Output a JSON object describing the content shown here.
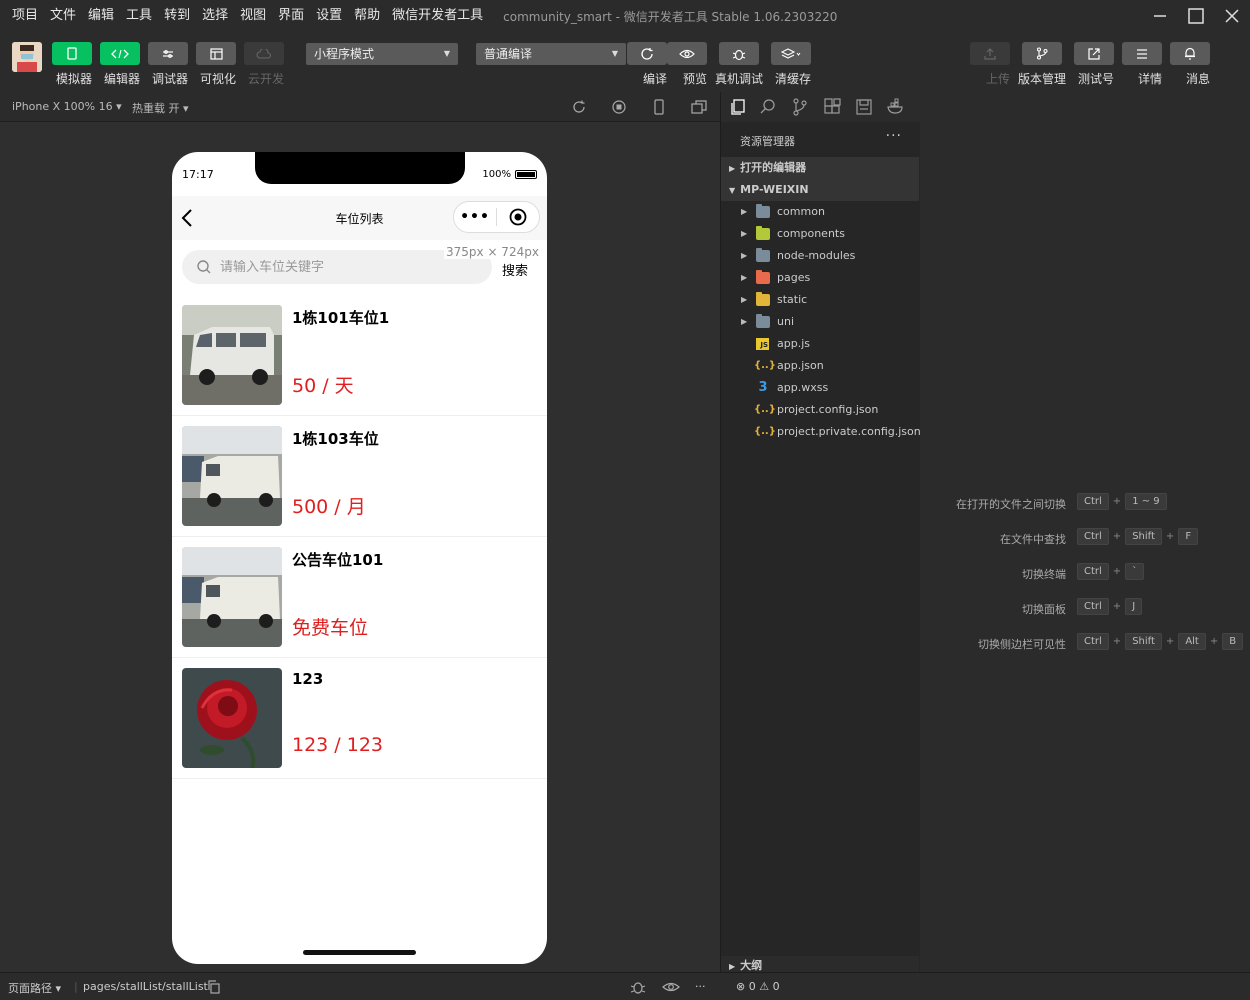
{
  "menu": {
    "items": [
      "项目",
      "文件",
      "编辑",
      "工具",
      "转到",
      "选择",
      "视图",
      "界面",
      "设置",
      "帮助",
      "微信开发者工具"
    ],
    "window_title": "community_smart - 微信开发者工具 Stable 1.06.2303220"
  },
  "toolbar": {
    "simulator": "模拟器",
    "editor": "编辑器",
    "debugger": "调试器",
    "visual": "可视化",
    "cloud": "云开发",
    "mode_select": "小程序模式",
    "compile_select": "普通编译",
    "compile": "编译",
    "preview": "预览",
    "real_debug": "真机调试",
    "clear_cache": "清缓存",
    "upload": "上传",
    "version": "版本管理",
    "test": "测试号",
    "details": "详情",
    "messages": "消息"
  },
  "simbar": {
    "device": "iPhone X 100% 16 ▾",
    "hot_reload": "热重载 开 ▾"
  },
  "phone": {
    "time": "17:17",
    "battery": "100%",
    "nav_title": "车位列表",
    "capsule_dots": "•••",
    "search_placeholder": "请输入车位关键字",
    "search_button": "搜索",
    "size_tip": "375px × 724px",
    "stalls": [
      {
        "name": "1栋101车位1",
        "price": "50 / 天"
      },
      {
        "name": "1栋103车位",
        "price": "500 / 月"
      },
      {
        "name": "公告车位101",
        "price": "免费车位"
      },
      {
        "name": "123",
        "price": "123 / 123"
      }
    ]
  },
  "explorer": {
    "title": "资源管理器",
    "more": "···",
    "open_editors": "打开的编辑器",
    "project": "MP-WEIXIN",
    "folders": [
      "common",
      "components",
      "node-modules",
      "pages",
      "static",
      "uni"
    ],
    "files": [
      "app.js",
      "app.json",
      "app.wxss",
      "project.config.json",
      "project.private.config.json"
    ],
    "file_icons": [
      "JS",
      "{..}",
      "3",
      "{..}",
      "{..}"
    ],
    "outline": "大纲"
  },
  "shortcuts": [
    {
      "desc": "在打开的文件之间切换",
      "keys": [
        "Ctrl",
        "1 ~ 9"
      ]
    },
    {
      "desc": "在文件中查找",
      "keys": [
        "Ctrl",
        "Shift",
        "F"
      ]
    },
    {
      "desc": "切换终端",
      "keys": [
        "Ctrl",
        "`"
      ]
    },
    {
      "desc": "切换面板",
      "keys": [
        "Ctrl",
        "J"
      ]
    },
    {
      "desc": "切换侧边栏可见性",
      "keys": [
        "Ctrl",
        "Shift",
        "Alt",
        "B"
      ]
    }
  ],
  "bottombar": {
    "page_path_label": "页面路径 ▾",
    "page_path": "pages/stallList/stallList",
    "errors": "⊗ 0 ⚠ 0",
    "more": "···"
  },
  "colors": {
    "green": "#07c160",
    "price_red": "#e02020"
  }
}
